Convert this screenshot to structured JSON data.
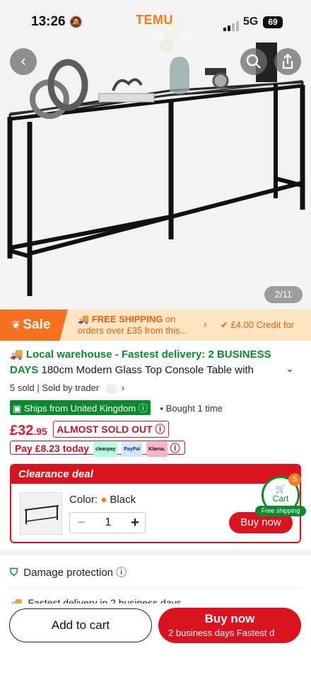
{
  "status_bar": {
    "time": "13:26",
    "brand": "TEMU",
    "network": "5G",
    "battery": "69"
  },
  "hero": {
    "image_counter": "2/11"
  },
  "promo": {
    "sale_label": "Sale",
    "shipping_bold": "FREE SHIPPING",
    "shipping_rest": " on",
    "shipping_line2": "orders over £35 from this...",
    "credit": "£4.00 Credit for"
  },
  "product": {
    "delivery": "Local warehouse - Fastest delivery: 2 BUSINESS DAYS",
    "title": " 180cm Modern Glass Top Console Table with",
    "sold": "5 sold",
    "seller": "Sold by trader",
    "ships_from": "Ships from United Kingdom",
    "bought": "Bought 1 time",
    "price_main": "£32",
    "price_cents": ".95",
    "stock_badge": "ALMOST SOLD OUT",
    "pay_today": "Pay £8.23 today",
    "pay_logos": [
      "clearpay",
      "PayPal",
      "Klarna."
    ]
  },
  "clearance": {
    "heading": "Clearance deal",
    "color_label": "Color:",
    "color_value": "Black",
    "quantity": "1",
    "buy_label": "Buy now",
    "cart_label": "Cart",
    "cart_count": "5",
    "free_shipping": "Free shipping"
  },
  "services": {
    "damage": "Damage protection",
    "fastest": "Fastest delivery in 2 business days"
  },
  "bottom_bar": {
    "add_to_cart": "Add to cart",
    "buy_now": "Buy now",
    "buy_sub": "2 business days   Fastest d"
  },
  "colors": {
    "accent_red": "#d9131f",
    "temu_orange": "#f57d1f",
    "green": "#0a8a2e"
  }
}
